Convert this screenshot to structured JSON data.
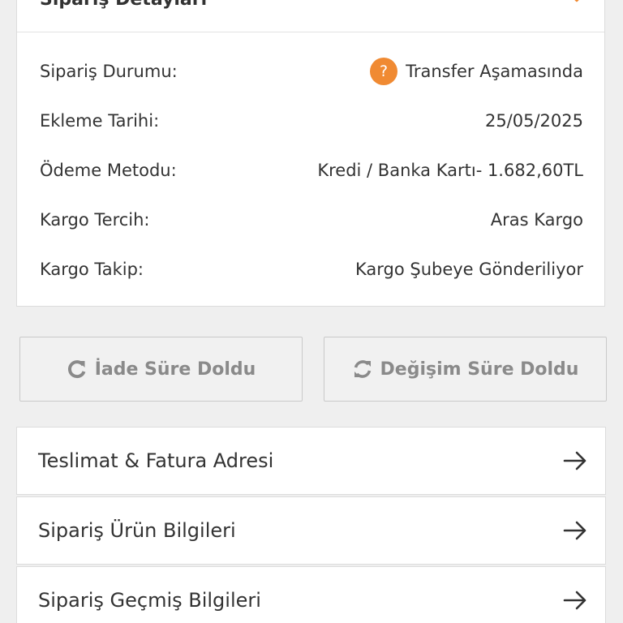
{
  "card": {
    "title": "Sipariş Detayları",
    "rows": [
      {
        "label": "Sipariş Durumu:",
        "value": "Transfer Aşamasında",
        "icon": "question-icon"
      },
      {
        "label": "Ekleme Tarihi:",
        "value": "25/05/2025"
      },
      {
        "label": "Ödeme Metodu:",
        "value": "Kredi / Banka Kartı- 1.682,60TL"
      },
      {
        "label": "Kargo Tercih:",
        "value": "Aras Kargo"
      },
      {
        "label": "Kargo Takip:",
        "value": "Kargo Şubeye Gönderiliyor"
      }
    ]
  },
  "actions": {
    "return_label": "İade Süre Doldu",
    "exchange_label": "Değişim Süre Doldu"
  },
  "nav": [
    {
      "label": "Teslimat & Fatura Adresi"
    },
    {
      "label": "Sipariş Ürün Bilgileri"
    },
    {
      "label": "Sipariş Geçmiş Bilgileri"
    }
  ],
  "colors": {
    "accent": "#f08a32",
    "disabled_text": "#8a8a8a",
    "text": "#333333",
    "background": "#efefef"
  }
}
